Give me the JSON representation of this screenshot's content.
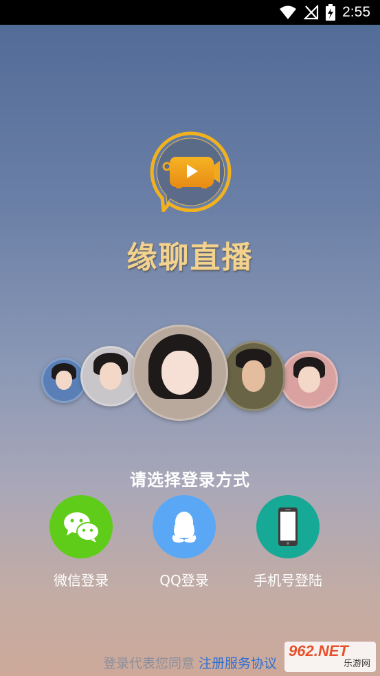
{
  "status_bar": {
    "time": "2:55",
    "icons": [
      "wifi-icon",
      "no-signal-icon",
      "battery-charging-icon"
    ]
  },
  "app": {
    "title": "缘聊直播",
    "logo_icon": "video-chat-logo-icon",
    "brand_color": "#f0a81f"
  },
  "login": {
    "prompt": "请选择登录方式",
    "options": [
      {
        "label": "微信登录",
        "icon": "wechat-icon",
        "color": "#5fcc1a"
      },
      {
        "label": "QQ登录",
        "icon": "qq-penguin-icon",
        "color": "#5aa8f5"
      },
      {
        "label": "手机号登陆",
        "icon": "phone-icon",
        "color": "#16a996"
      }
    ]
  },
  "agreement": {
    "prefix": "登录代表您同意",
    "link": "注册服务协议"
  },
  "watermark": {
    "brand": "962.NET",
    "name": "乐游网"
  }
}
